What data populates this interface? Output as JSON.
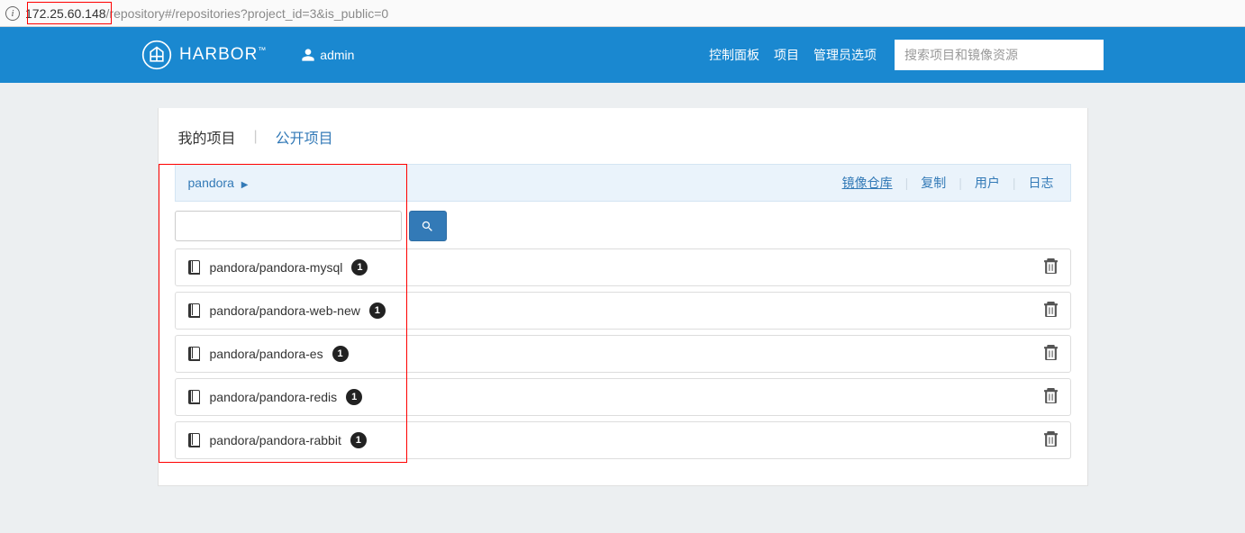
{
  "address_bar": {
    "ip": "172.25.60.148",
    "path": "/repository#/repositories?project_id=3&is_public=0"
  },
  "header": {
    "brand": "HARBOR",
    "user_icon": "user-icon",
    "username": "admin",
    "nav": {
      "dashboard": "控制面板",
      "projects": "项目",
      "admin_opts": "管理员选项"
    },
    "search_placeholder": "搜索项目和镜像资源"
  },
  "tabs": {
    "my_projects": "我的项目",
    "separator": "|",
    "public_projects": "公开项目"
  },
  "breadcrumb": {
    "project_name": "pandora",
    "right_links": {
      "repos": "镜像仓库",
      "replication": "复制",
      "users": "用户",
      "logs": "日志"
    }
  },
  "filter": {
    "input_value": ""
  },
  "repositories": [
    {
      "name": "pandora/pandora-mysql",
      "count": "1"
    },
    {
      "name": "pandora/pandora-web-new",
      "count": "1"
    },
    {
      "name": "pandora/pandora-es",
      "count": "1"
    },
    {
      "name": "pandora/pandora-redis",
      "count": "1"
    },
    {
      "name": "pandora/pandora-rabbit",
      "count": "1"
    }
  ]
}
